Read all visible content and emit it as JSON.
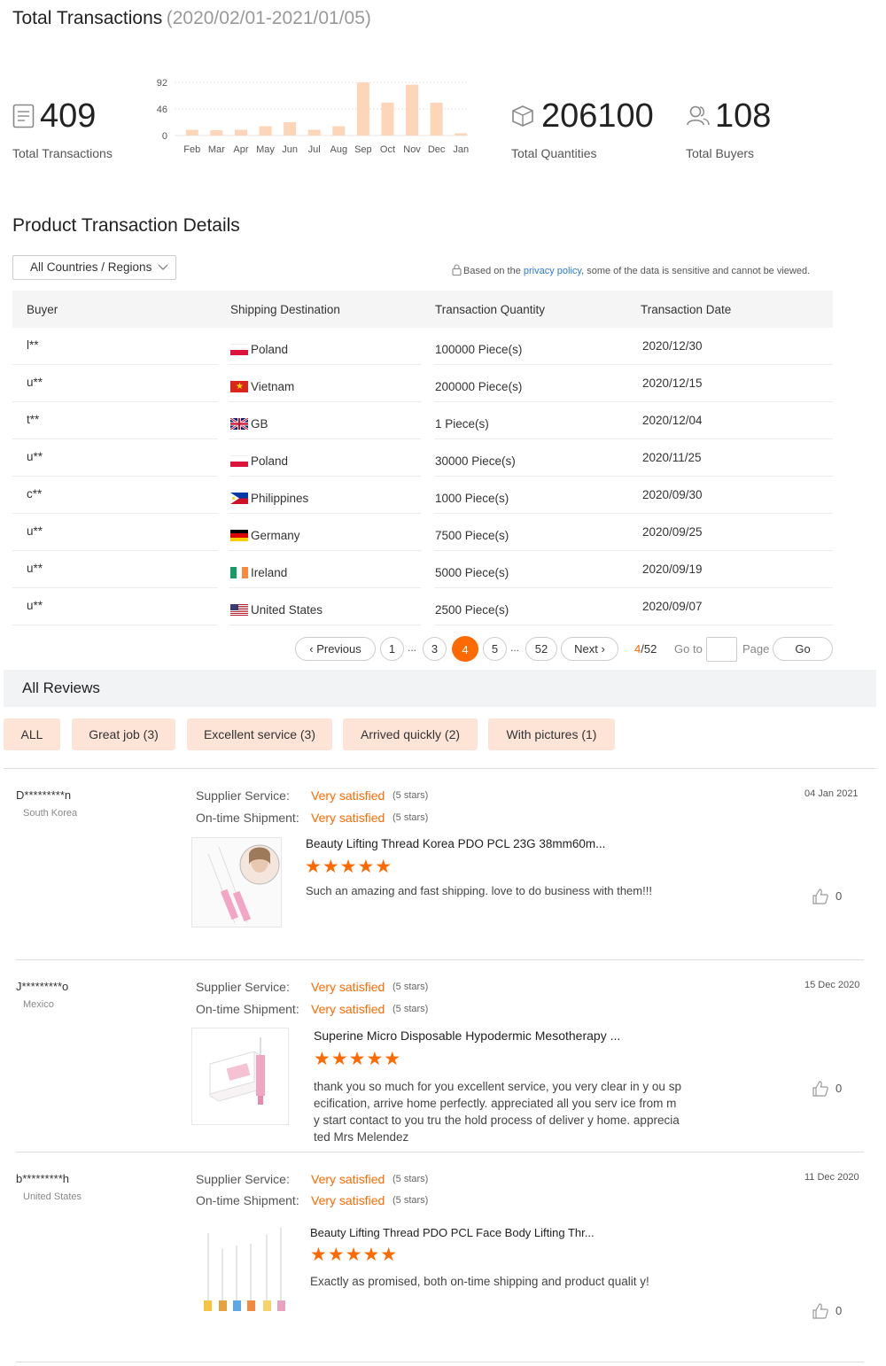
{
  "header": {
    "title": "Total Transactions",
    "range": "(2020/02/01-2021/01/05)"
  },
  "stats": {
    "transactions": {
      "value": "409",
      "label": "Total Transactions"
    },
    "quantities": {
      "value": "206100",
      "label": "Total Quantities"
    },
    "buyers": {
      "value": "108",
      "label": "Total Buyers"
    }
  },
  "chart_data": {
    "type": "bar",
    "categories": [
      "Feb",
      "Mar",
      "Apr",
      "May",
      "Jun",
      "Jul",
      "Aug",
      "Sep",
      "Oct",
      "Nov",
      "Dec",
      "Jan"
    ],
    "values": [
      10,
      9,
      10,
      16,
      23,
      10,
      16,
      92,
      57,
      88,
      57,
      4
    ],
    "ytick_labels": [
      "92",
      "46",
      "0"
    ],
    "ylim": [
      0,
      92
    ],
    "color": "#fdd5b8"
  },
  "details": {
    "title": "Product Transaction Details",
    "region_select": "All Countries / Regions",
    "notice_prefix": "Based on the ",
    "notice_link": "privacy policy",
    "notice_suffix": ", some of the data is sensitive and cannot be viewed.",
    "columns": [
      "Buyer",
      "Shipping Destination",
      "Transaction Quantity",
      "Transaction Date"
    ],
    "rows": [
      {
        "buyer": "l**",
        "country": "Poland",
        "flag": "pl",
        "qty": "100000 Piece(s)",
        "date": "2020/12/30"
      },
      {
        "buyer": "u**",
        "country": "Vietnam",
        "flag": "vn",
        "qty": "200000 Piece(s)",
        "date": "2020/12/15"
      },
      {
        "buyer": "t**",
        "country": "GB",
        "flag": "gb",
        "qty": "1 Piece(s)",
        "date": "2020/12/04"
      },
      {
        "buyer": "u**",
        "country": "Poland",
        "flag": "pl",
        "qty": "30000 Piece(s)",
        "date": "2020/11/25"
      },
      {
        "buyer": "c**",
        "country": "Philippines",
        "flag": "ph",
        "qty": "1000 Piece(s)",
        "date": "2020/09/30"
      },
      {
        "buyer": "u**",
        "country": "Germany",
        "flag": "de",
        "qty": "7500 Piece(s)",
        "date": "2020/09/25"
      },
      {
        "buyer": "u**",
        "country": "Ireland",
        "flag": "ie",
        "qty": "5000 Piece(s)",
        "date": "2020/09/19"
      },
      {
        "buyer": "u**",
        "country": "United States",
        "flag": "us",
        "qty": "2500 Piece(s)",
        "date": "2020/09/07"
      }
    ]
  },
  "pagination": {
    "previous": "Previous",
    "next": "Next",
    "pages": [
      "1",
      "3",
      "4",
      "5",
      "52"
    ],
    "ellipsis": "...",
    "current": "4",
    "total": "/52",
    "goto": "Go to",
    "page": "Page",
    "go": "Go"
  },
  "reviews": {
    "title": "All Reviews",
    "filters": [
      "ALL",
      "Great job (3)",
      "Excellent service (3)",
      "Arrived quickly (2)",
      "With pictures (1)"
    ],
    "labels": {
      "supplier": "Supplier Service:",
      "shipment": "On-time Shipment:",
      "value": "Very satisfied",
      "stars": "(5 stars)"
    },
    "items": [
      {
        "user": "D*********n",
        "country": "South Korea",
        "date": "04 Jan 2021",
        "product": "Beauty Lifting Thread Korea PDO PCL 23G 38mm60m...",
        "text": "Such an amazing and fast shipping. love to do business with them!!!",
        "likes": "0"
      },
      {
        "user": "J*********o",
        "country": "Mexico",
        "date": "15 Dec 2020",
        "product": "Superine Micro Disposable Hypodermic Mesotherapy ...",
        "text": "thank you so much for you excellent service, you very clear in y ou specification, arrive home perfectly. appreciated all you serv ice from my start contact to you tru the hold process of deliver y home. appreciated Mrs Melendez",
        "likes": "0"
      },
      {
        "user": "b*********h",
        "country": "United States",
        "date": "11 Dec 2020",
        "product": "Beauty Lifting Thread PDO PCL Face Body Lifting Thr...",
        "text": "Exactly as promised, both on-time shipping and product qualit y!",
        "likes": "0"
      }
    ]
  }
}
